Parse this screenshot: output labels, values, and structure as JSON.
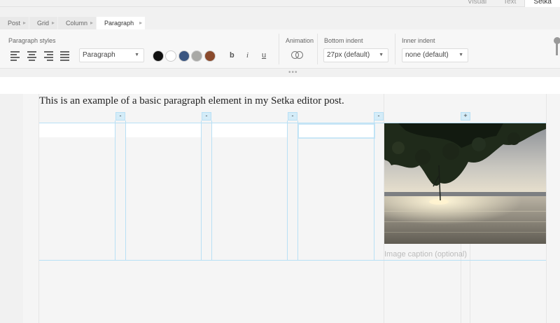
{
  "modes": {
    "visual": "Visual",
    "text": "Text",
    "setka": "Setka"
  },
  "breadcrumb": [
    {
      "label": "Post"
    },
    {
      "label": "Grid"
    },
    {
      "label": "Column"
    },
    {
      "label": "Paragraph"
    }
  ],
  "toolbar": {
    "paragraph_styles_label": "Paragraph styles",
    "style_select": "Paragraph",
    "animation_label": "Animation",
    "bottom_indent_label": "Bottom indent",
    "bottom_indent_value": "27px (default)",
    "inner_indent_label": "Inner indent",
    "inner_indent_value": "none (default)",
    "bold": "b",
    "italic": "i",
    "underline": "u",
    "colors": [
      "#111111",
      "#ffffff",
      "#3a5580",
      "#a9a9a6",
      "#8a4a2c"
    ]
  },
  "editor": {
    "paragraph_text": "This is an example of a basic paragraph element in my Setka editor post.",
    "image_caption_placeholder": "Image caption (optional)",
    "column_tabs": [
      "-",
      "-",
      "-",
      "-",
      "+"
    ]
  }
}
